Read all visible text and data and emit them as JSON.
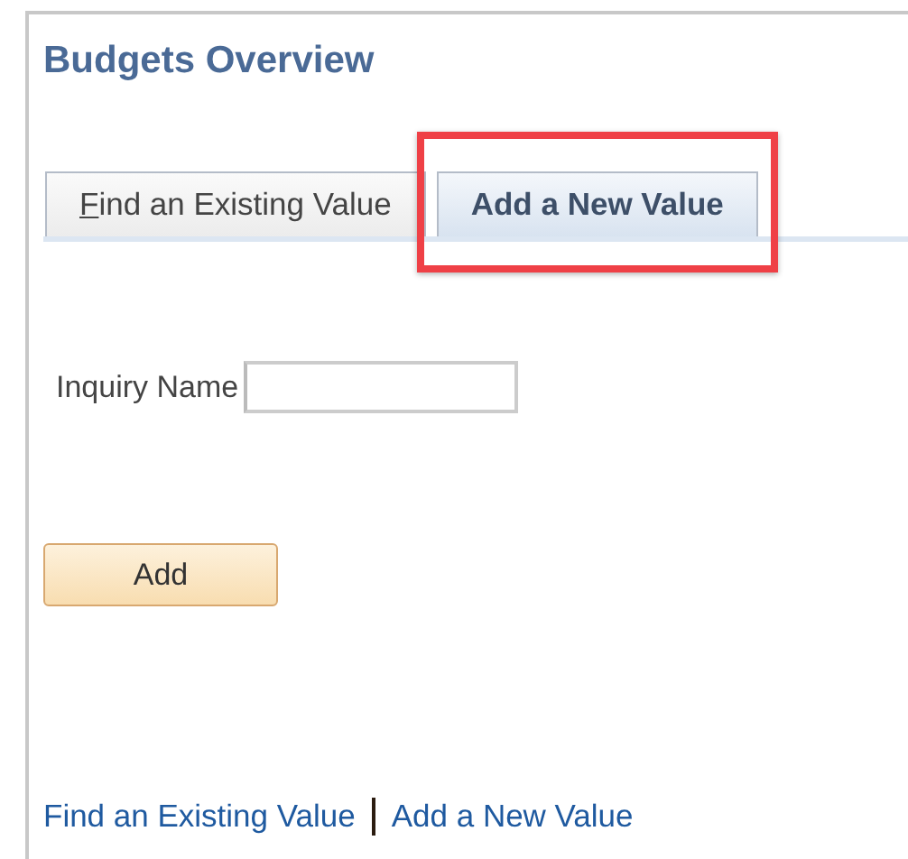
{
  "title": "Budgets Overview",
  "tabs": [
    {
      "label": "Find an Existing Value",
      "selected": false,
      "access_key_underlined": true,
      "highlighted": false
    },
    {
      "label": "Add a New Value",
      "selected": true,
      "access_key_underlined": false,
      "highlighted": true
    }
  ],
  "field": {
    "label": "Inquiry Name"
  },
  "button": "Add",
  "links": [
    "Find an Existing Value",
    "Add a New Value"
  ]
}
